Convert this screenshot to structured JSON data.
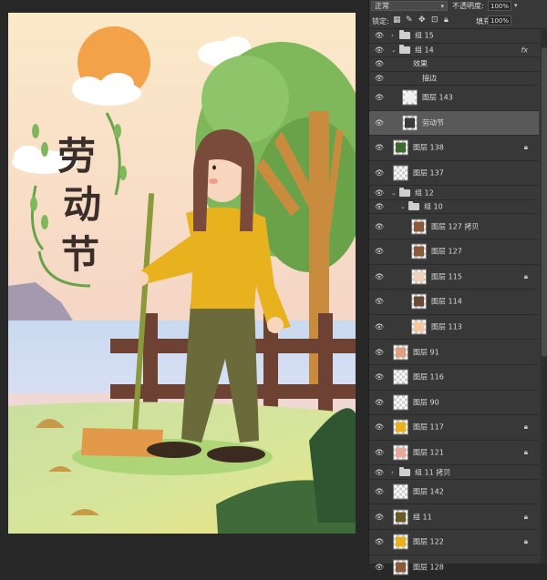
{
  "toolbar": {
    "blend_mode": "正常",
    "opacity_label": "不透明度:",
    "opacity_value": "100%",
    "lock_label": "锁定:",
    "fill_label": "填充:",
    "fill_value": "100%"
  },
  "artwork": {
    "title_chars": [
      "劳",
      "动",
      "节"
    ]
  },
  "layers": [
    {
      "name": "组 15",
      "type": "group",
      "indent": 0,
      "collapsed": true,
      "visible": true
    },
    {
      "name": "组 14",
      "type": "group",
      "indent": 0,
      "collapsed": false,
      "visible": true,
      "fx": "fx"
    },
    {
      "name": "效果",
      "type": "effect",
      "indent": 1,
      "visible": true
    },
    {
      "name": "描边",
      "type": "effect",
      "indent": 2,
      "visible": true
    },
    {
      "name": "图层 143",
      "type": "layer",
      "indent": 1,
      "visible": true,
      "thumb": "#f0f0f0"
    },
    {
      "name": "劳动节",
      "type": "layer",
      "indent": 1,
      "visible": true,
      "selected": true,
      "thumb": "#3a3a3a"
    },
    {
      "name": "图层 138",
      "type": "layer",
      "indent": 0,
      "visible": true,
      "locked": true,
      "thumb": "#3d6b2f"
    },
    {
      "name": "图层 137",
      "type": "layer",
      "indent": 0,
      "visible": true,
      "thumb": ""
    },
    {
      "name": "组 12",
      "type": "group",
      "indent": 0,
      "collapsed": false,
      "visible": true
    },
    {
      "name": "组 10",
      "type": "group",
      "indent": 1,
      "collapsed": false,
      "visible": true
    },
    {
      "name": "图层 127 拷贝",
      "type": "layer",
      "indent": 2,
      "visible": true,
      "thumb": "#8a5a3a"
    },
    {
      "name": "图层 127",
      "type": "layer",
      "indent": 2,
      "visible": true,
      "thumb": "#8a5a3a"
    },
    {
      "name": "图层 115",
      "type": "layer",
      "indent": 2,
      "visible": true,
      "locked": true,
      "thumb": "#f0d0b8"
    },
    {
      "name": "图层 114",
      "type": "layer",
      "indent": 2,
      "visible": true,
      "thumb": "#6b4a3a"
    },
    {
      "name": "图层 113",
      "type": "layer",
      "indent": 2,
      "visible": true,
      "thumb": "#f5c9a0"
    },
    {
      "name": "图层 91",
      "type": "layer",
      "indent": 0,
      "visible": true,
      "thumb": "#e0a080"
    },
    {
      "name": "图层 116",
      "type": "layer",
      "indent": 0,
      "visible": true,
      "thumb": ""
    },
    {
      "name": "图层 90",
      "type": "layer",
      "indent": 0,
      "visible": true,
      "thumb": ""
    },
    {
      "name": "图层 117",
      "type": "layer",
      "indent": 0,
      "visible": true,
      "locked": true,
      "thumb": "#e8b21f"
    },
    {
      "name": "图层 121",
      "type": "layer",
      "indent": 0,
      "visible": true,
      "locked": true,
      "thumb": "#e8a89a"
    },
    {
      "name": "组 11 拷贝",
      "type": "group",
      "indent": 0,
      "collapsed": true,
      "visible": true
    },
    {
      "name": "图层 142",
      "type": "layer",
      "indent": 0,
      "visible": true,
      "thumb": ""
    },
    {
      "name": "组 11",
      "type": "layer",
      "indent": 0,
      "visible": true,
      "locked": true,
      "thumb": "#6b5a2a"
    },
    {
      "name": "图层 122",
      "type": "layer",
      "indent": 0,
      "visible": true,
      "locked": true,
      "thumb": "#e8b21f"
    },
    {
      "name": "图层 128",
      "type": "layer",
      "indent": 0,
      "visible": true,
      "thumb": "#8a5a3a"
    }
  ],
  "icons": {
    "eye": "eye-icon",
    "lock": "lock-icon",
    "folder": "folder-icon"
  },
  "colors": {
    "panel_bg": "#383838",
    "selected_row": "#595959",
    "sweater": "#e8b21f",
    "pants": "#6b6a3a",
    "sky": "#f8dfc4"
  }
}
